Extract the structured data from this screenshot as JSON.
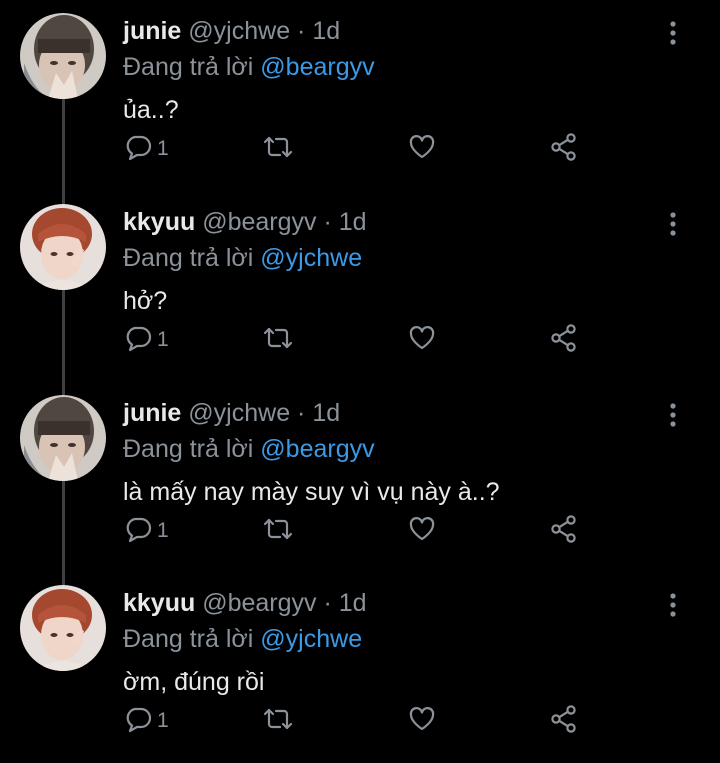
{
  "colors": {
    "background": "#000000",
    "name": "#e7e9ea",
    "muted": "#8b9299",
    "mention": "#3b9ae8",
    "thread_line": "#3d4146"
  },
  "icons": {
    "more": "vertical-ellipsis-icon",
    "reply": "comment-bubble-icon",
    "retweet": "retweet-icon",
    "like": "heart-icon",
    "share": "share-icon"
  },
  "tweets": [
    {
      "name": "junie",
      "handle": "@yjchwe",
      "dot": "·",
      "time": "1d",
      "reply_prefix": "Đang trả lời",
      "reply_to": "@beargyv",
      "text": "ủa..?",
      "reply_count": "1"
    },
    {
      "name": "kkyuu",
      "handle": "@beargyv",
      "dot": "·",
      "time": "1d",
      "reply_prefix": "Đang trả lời",
      "reply_to": "@yjchwe",
      "text": "hở?",
      "reply_count": "1"
    },
    {
      "name": "junie",
      "handle": "@yjchwe",
      "dot": "·",
      "time": "1d",
      "reply_prefix": "Đang trả lời",
      "reply_to": "@beargyv",
      "text": "là mấy nay mày suy vì vụ này à..?",
      "reply_count": "1"
    },
    {
      "name": "kkyuu",
      "handle": "@beargyv",
      "dot": "·",
      "time": "1d",
      "reply_prefix": "Đang trả lời",
      "reply_to": "@yjchwe",
      "text": "ờm, đúng rồi",
      "reply_count": "1"
    }
  ]
}
